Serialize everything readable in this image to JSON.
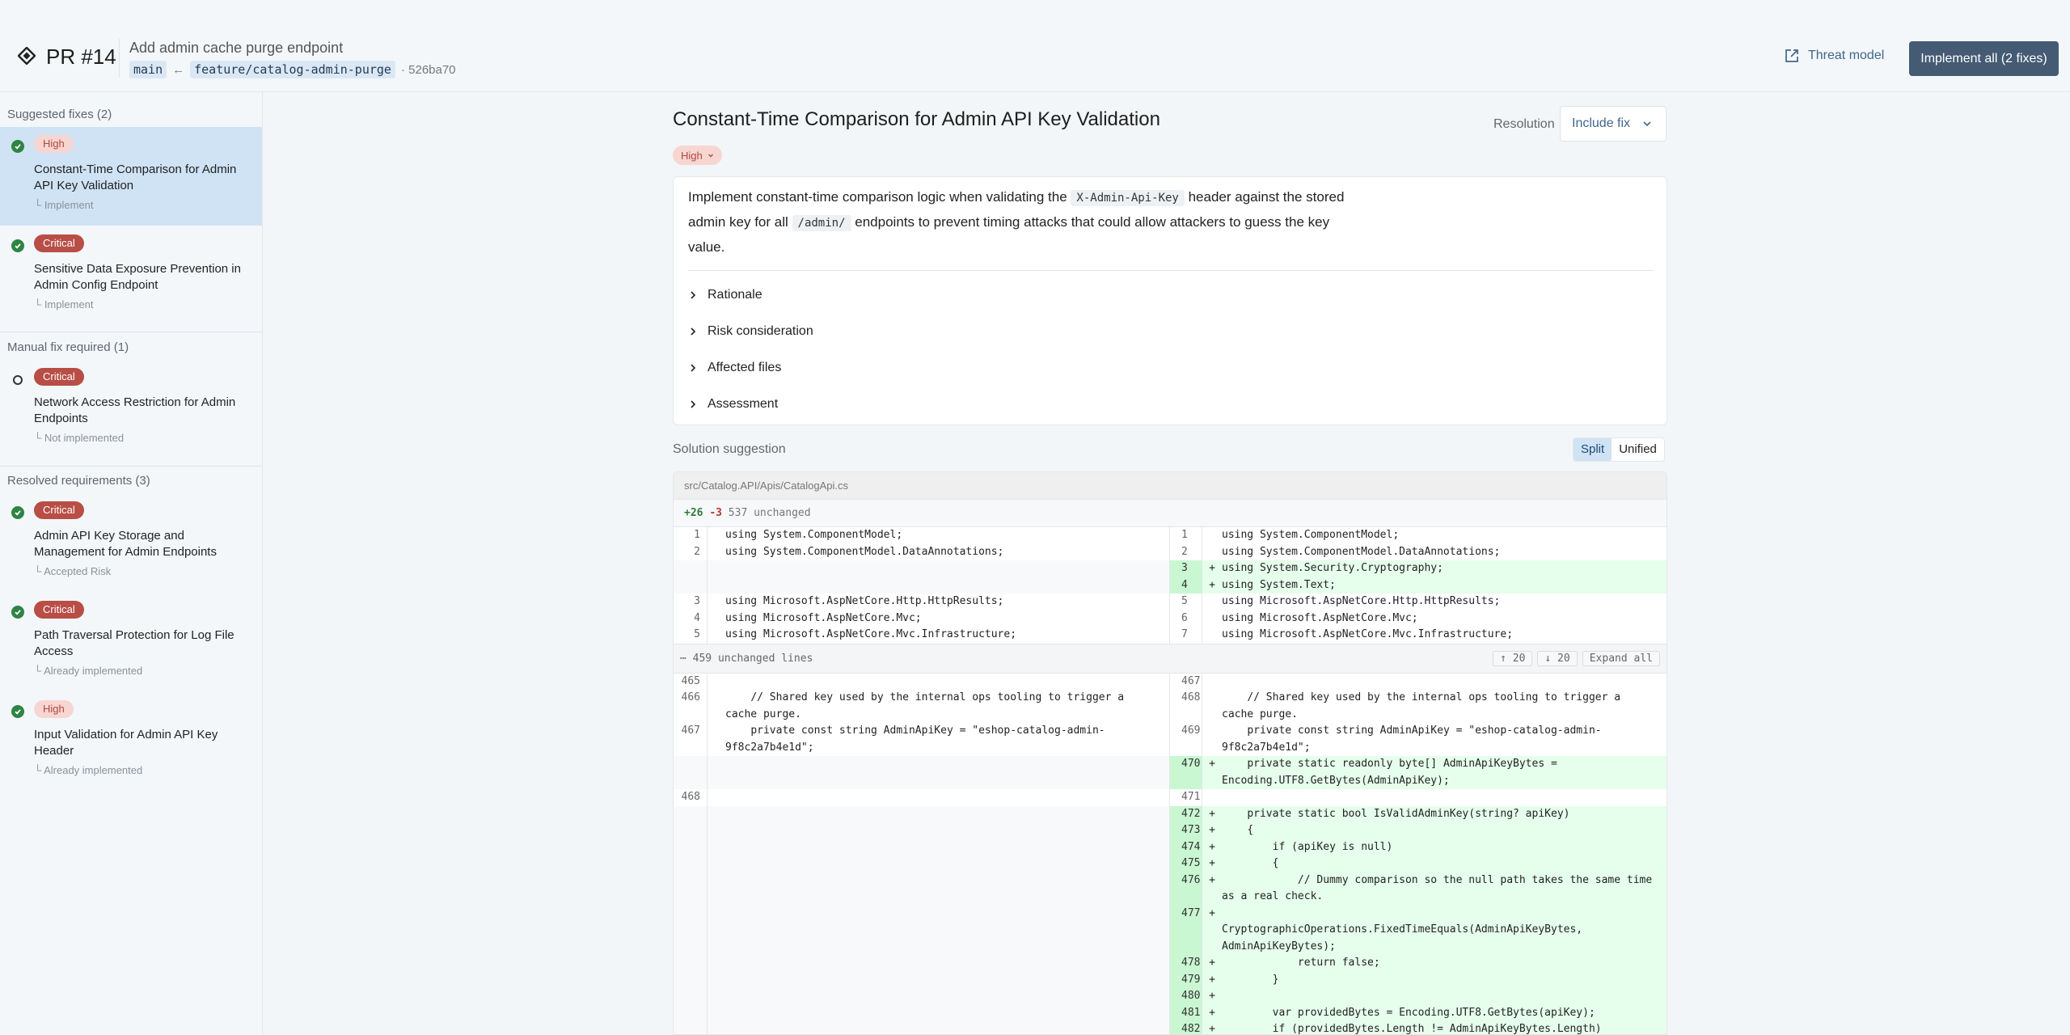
{
  "header": {
    "pr_number": "PR #14",
    "pr_title": "Add admin cache purge endpoint",
    "base_branch": "main",
    "arrow": "←",
    "head_branch": "feature/catalog-admin-purge",
    "commit": "· 526ba70",
    "threat_model": "Threat model",
    "implement_all": "Implement all (2 fixes)"
  },
  "sidebar": {
    "sections": {
      "suggested": "Suggested fixes (2)",
      "manual": "Manual fix required (1)",
      "resolved": "Resolved requirements (3)"
    },
    "items": [
      {
        "severity": "High",
        "title": "Constant-Time Comparison for Admin API Key Validation",
        "status": "└ Implement"
      },
      {
        "severity": "Critical",
        "title": "Sensitive Data Exposure Prevention in Admin Config Endpoint",
        "status": "└ Implement"
      },
      {
        "severity": "Critical",
        "title": "Network Access Restriction for Admin Endpoints",
        "status": "└ Not implemented"
      },
      {
        "severity": "Critical",
        "title": "Admin API Key Storage and Management for Admin Endpoints",
        "status": "└ Accepted Risk"
      },
      {
        "severity": "Critical",
        "title": "Path Traversal Protection for Log File Access",
        "status": "└ Already implemented"
      },
      {
        "severity": "High",
        "title": "Input Validation for Admin API Key Header",
        "status": "└ Already implemented"
      }
    ]
  },
  "main": {
    "title": "Constant-Time Comparison for Admin API Key Validation",
    "resolution_label": "Resolution",
    "resolution_value": "Include fix",
    "severity": "High",
    "desc": {
      "p1": "Implement constant-time comparison logic when validating the",
      "code1": "X-Admin-Api-Key",
      "p2": "header against the stored admin key for all",
      "code2": "/admin/",
      "p3": "endpoints to prevent timing attacks that could allow attackers to guess the key value."
    },
    "accordions": [
      "Rationale",
      "Risk consideration",
      "Affected files",
      "Assessment"
    ],
    "solution_label": "Solution suggestion",
    "view_split": "Split",
    "view_unified": "Unified"
  },
  "diff": {
    "path": "src/Catalog.API/Apis/CatalogApi.cs",
    "added": "+26",
    "removed": "-3",
    "unchanged": "537 unchanged",
    "collapsed": "⋯ 459 unchanged lines",
    "up": "↑ 20",
    "down": "↓ 20",
    "expand": "Expand all",
    "top_rows": [
      {
        "ln": "1",
        "l": "using System.ComponentModel;",
        "rn": "1",
        "r": "using System.ComponentModel;"
      },
      {
        "ln": "2",
        "l": "using System.ComponentModel.DataAnnotations;",
        "rn": "2",
        "r": "using System.ComponentModel.DataAnnotations;"
      },
      {
        "add": true,
        "rn": "3",
        "r": "using System.Security.Cryptography;"
      },
      {
        "add": true,
        "rn": "4",
        "r": "using System.Text;"
      },
      {
        "ln": "3",
        "l": "using Microsoft.AspNetCore.Http.HttpResults;",
        "rn": "5",
        "r": "using Microsoft.AspNetCore.Http.HttpResults;"
      },
      {
        "ln": "4",
        "l": "using Microsoft.AspNetCore.Mvc;",
        "rn": "6",
        "r": "using Microsoft.AspNetCore.Mvc;"
      },
      {
        "ln": "5",
        "l": "using Microsoft.AspNetCore.Mvc.Infrastructure;",
        "rn": "7",
        "r": "using Microsoft.AspNetCore.Mvc.Infrastructure;"
      }
    ],
    "bottom_rows": [
      {
        "ln": "465",
        "l": "",
        "rn": "467",
        "r": ""
      },
      {
        "ln": "466",
        "l": "    // Shared key used by the internal ops tooling to trigger a cache purge.",
        "rn": "468",
        "r": "    // Shared key used by the internal ops tooling to trigger a cache purge."
      },
      {
        "ln": "467",
        "l": "    private const string AdminApiKey = \"eshop-catalog-admin-9f8c2a7b4e1d\";",
        "rn": "469",
        "r": "    private const string AdminApiKey = \"eshop-catalog-admin-9f8c2a7b4e1d\";"
      },
      {
        "add": true,
        "rn": "470",
        "r": "    private static readonly byte[] AdminApiKeyBytes = Encoding.UTF8.GetBytes(AdminApiKey);"
      },
      {
        "ln": "468",
        "l": "",
        "rn": "471",
        "r": ""
      },
      {
        "add": true,
        "rn": "472",
        "r": "    private static bool IsValidAdminKey(string? apiKey)"
      },
      {
        "add": true,
        "rn": "473",
        "r": "    {"
      },
      {
        "add": true,
        "rn": "474",
        "r": "        if (apiKey is null)"
      },
      {
        "add": true,
        "rn": "475",
        "r": "        {"
      },
      {
        "add": true,
        "rn": "476",
        "r": "            // Dummy comparison so the null path takes the same time as a real check."
      },
      {
        "add": true,
        "rn": "477",
        "r": "            CryptographicOperations.FixedTimeEquals(AdminApiKeyBytes, AdminApiKeyBytes);"
      },
      {
        "add": true,
        "rn": "478",
        "r": "            return false;"
      },
      {
        "add": true,
        "rn": "479",
        "r": "        }"
      },
      {
        "add": true,
        "rn": "480",
        "r": ""
      },
      {
        "add": true,
        "rn": "481",
        "r": "        var providedBytes = Encoding.UTF8.GetBytes(apiKey);"
      },
      {
        "add": true,
        "rn": "482",
        "r": "        if (providedBytes.Length != AdminApiKeyBytes.Length)"
      }
    ]
  }
}
